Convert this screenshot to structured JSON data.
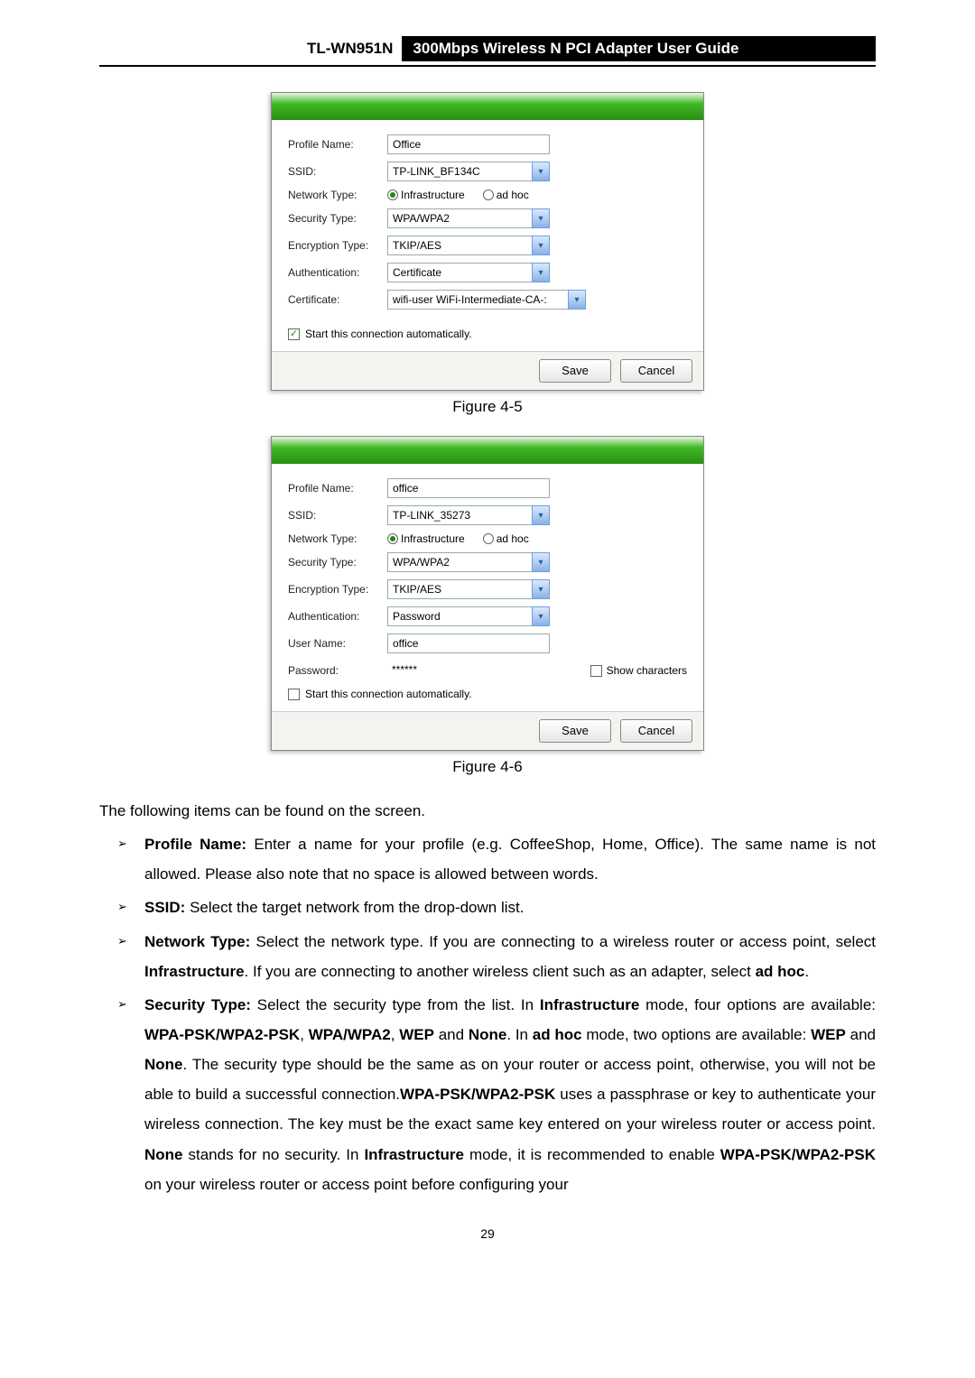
{
  "header": {
    "model": "TL-WN951N",
    "title": "300Mbps Wireless N PCI Adapter User Guide"
  },
  "dialog1": {
    "labels": {
      "profile": "Profile Name:",
      "ssid": "SSID:",
      "nettype": "Network Type:",
      "sectype": "Security Type:",
      "enctype": "Encryption Type:",
      "auth": "Authentication:",
      "cert": "Certificate:"
    },
    "values": {
      "profile": "Office",
      "ssid": "TP-LINK_BF134C",
      "infra": "Infrastructure",
      "adhoc": "ad hoc",
      "sectype": "WPA/WPA2",
      "enctype": "TKIP/AES",
      "auth": "Certificate",
      "cert": "wifi-user WiFi-Intermediate-CA-:"
    },
    "auto_label": "Start this connection automatically.",
    "auto_checked": true,
    "save": "Save",
    "cancel": "Cancel"
  },
  "fig1_caption": "Figure 4-5",
  "dialog2": {
    "labels": {
      "profile": "Profile Name:",
      "ssid": "SSID:",
      "nettype": "Network Type:",
      "sectype": "Security Type:",
      "enctype": "Encryption Type:",
      "auth": "Authentication:",
      "user": "User Name:",
      "pass": "Password:"
    },
    "values": {
      "profile": "office",
      "ssid": "TP-LINK_35273",
      "infra": "Infrastructure",
      "adhoc": "ad hoc",
      "sectype": "WPA/WPA2",
      "enctype": "TKIP/AES",
      "auth": "Password",
      "user": "office",
      "pass": "******"
    },
    "showchars_label": "Show characters",
    "auto_label": "Start this connection automatically.",
    "auto_checked": false,
    "save": "Save",
    "cancel": "Cancel"
  },
  "fig2_caption": "Figure 4-6",
  "intro": "The following items can be found on the screen.",
  "bullets": {
    "b1_label": "Profile Name:",
    "b1_text": " Enter a name for your profile (e.g. CoffeeShop, Home, Office). The same name is not allowed. Please also note that no space is allowed between words.",
    "b2_label": "SSID:",
    "b2_text": " Select the target network from the drop-down list.",
    "b3_label": "Network Type:",
    "b3_t1": " Select the network type. If you are connecting to a wireless router or access point, select ",
    "b3_s1": "Infrastructure",
    "b3_t2": ". If you are connecting to another wireless client such as an adapter, select ",
    "b3_s2": "ad hoc",
    "b3_t3": ".",
    "b4_label": "Security Type:",
    "b4_t1": " Select the security type from the list. In ",
    "b4_s1": "Infrastructure",
    "b4_t2": " mode, four options are available: ",
    "b4_s2": "WPA-PSK/WPA2-PSK",
    "b4_t3": ", ",
    "b4_s3": "WPA/WPA2",
    "b4_t4": ", ",
    "b4_s4": "WEP",
    "b4_t5": " and ",
    "b4_s5": "None",
    "b4_t6": ". In ",
    "b4_s6": "ad hoc",
    "b4_t7": " mode, two options are available: ",
    "b4_s7": "WEP",
    "b4_t8": " and ",
    "b4_s8": "None",
    "b4_t9": ". The security type should be the same as on your router or access point, otherwise, you will not be able to build a successful connection.",
    "b4_s9": "WPA-PSK/WPA2-PSK",
    "b4_t10": " uses a passphrase or key to authenticate your wireless connection. The key must be the exact same key entered on your wireless router or access point. ",
    "b4_s10": "None",
    "b4_t11": " stands for no security. In ",
    "b4_s11": "Infrastructure",
    "b4_t12": " mode, it is recommended to enable ",
    "b4_s12": "WPA-PSK/WPA2-PSK",
    "b4_t13": " on your wireless router or access point before configuring your"
  },
  "page_number": "29"
}
